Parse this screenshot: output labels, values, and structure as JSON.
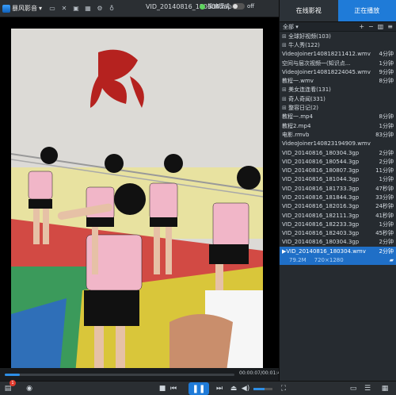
{
  "app": {
    "logo_text": "暴风影音",
    "file_title": "VID_20140816_180304.mp4",
    "toggle_label": "极速模式",
    "toggle_state": "off"
  },
  "tabs": [
    {
      "label": "在线影视",
      "active": false
    },
    {
      "label": "正在播放",
      "active": true
    }
  ],
  "list_toolbar": {
    "filter": "全部 ▾",
    "tool_icons": [
      "add-icon",
      "remove-icon",
      "delete-icon",
      "more-icon"
    ]
  },
  "playlist": [
    {
      "name": "全球好视频(103)",
      "duration": "",
      "type": "group"
    },
    {
      "name": "牛人秀(122)",
      "duration": "",
      "type": "group"
    },
    {
      "name": "VideoJoiner140818211412.wmv",
      "duration": "4分钟",
      "type": "item"
    },
    {
      "name": "空间与层次视频一(知识点...",
      "duration": "1分钟",
      "type": "item"
    },
    {
      "name": "VideoJoiner140818224045.wmv",
      "duration": "9分钟",
      "type": "item"
    },
    {
      "name": "教程一.wmv",
      "duration": "8分钟",
      "type": "item"
    },
    {
      "name": "美女连连看(131)",
      "duration": "",
      "type": "group"
    },
    {
      "name": "奇人奇闻(331)",
      "duration": "",
      "type": "group"
    },
    {
      "name": "整容日记(2)",
      "duration": "",
      "type": "group"
    },
    {
      "name": "教程一.mp4",
      "duration": "8分钟",
      "type": "item"
    },
    {
      "name": "教程2.mp4",
      "duration": "1分钟",
      "type": "item"
    },
    {
      "name": "电影.rmvb",
      "duration": "83分钟",
      "type": "item"
    },
    {
      "name": "VideoJoiner140823194909.wmv",
      "duration": "",
      "type": "item"
    },
    {
      "name": "VID_20140816_180304.3gp",
      "duration": "2分钟",
      "type": "item"
    },
    {
      "name": "VID_20140816_180544.3gp",
      "duration": "2分钟",
      "type": "item"
    },
    {
      "name": "VID_20140816_180807.3gp",
      "duration": "11分钟",
      "type": "item"
    },
    {
      "name": "VID_20140816_181044.3gp",
      "duration": "1分钟",
      "type": "item"
    },
    {
      "name": "VID_20140816_181733.3gp",
      "duration": "47秒钟",
      "type": "item"
    },
    {
      "name": "VID_20140816_181844.3gp",
      "duration": "33分钟",
      "type": "item"
    },
    {
      "name": "VID_20140816_182016.3gp",
      "duration": "24秒钟",
      "type": "item"
    },
    {
      "name": "VID_20140816_182111.3gp",
      "duration": "41秒钟",
      "type": "item"
    },
    {
      "name": "VID_20140816_182233.3gp",
      "duration": "1分钟",
      "type": "item"
    },
    {
      "name": "VID_20140816_182403.3gp",
      "duration": "45秒钟",
      "type": "item"
    },
    {
      "name": "VID_20140816_180304.3gp",
      "duration": "2分钟",
      "type": "item"
    },
    {
      "name": "VID_20140816_180304.wmv",
      "duration": "2分钟",
      "type": "current"
    }
  ],
  "current_meta": {
    "size": "79.2M",
    "resolution": "720×1280"
  },
  "seek": {
    "time": "00:00:07/00:01:46",
    "progress": 0.066
  },
  "volume": {
    "level": 0.6
  },
  "notification_count": "1",
  "colors": {
    "accent": "#1f7bd8",
    "panel_bg": "#262b30",
    "current_row": "#1f6fc7"
  }
}
